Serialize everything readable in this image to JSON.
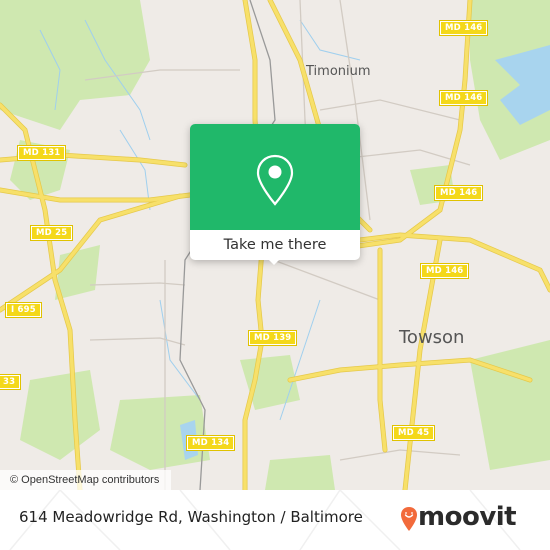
{
  "map": {
    "place_labels": [
      {
        "name": "Timonium",
        "kind": "suburb"
      },
      {
        "name": "Towson",
        "kind": "town"
      }
    ],
    "route_shields": [
      "MD 146",
      "MD 146",
      "MD 146",
      "MD 146",
      "MD 131",
      "MD 25",
      "I 695",
      "33",
      "MD 139",
      "MD 134",
      "MD 45"
    ],
    "colors": {
      "land": "#efebe7",
      "park": "#cfe8b0",
      "water": "#a8d4ee",
      "major_road": "#f7e06a",
      "minor_road": "#cfc8c0",
      "shield": "#f4d81a"
    }
  },
  "popup": {
    "icon": "location-pin-icon",
    "button_label": "Take me there",
    "accent_color": "#20b86a"
  },
  "attribution": "© OpenStreetMap contributors",
  "footer": {
    "address": "614 Meadowridge Rd, Washington / Baltimore",
    "brand": "moovit",
    "brand_color": "#f26a3b"
  }
}
